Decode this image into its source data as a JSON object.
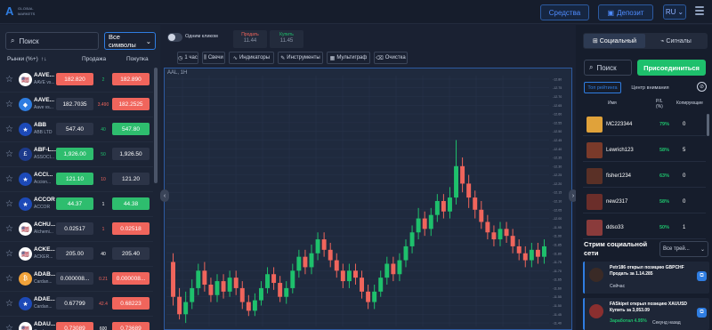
{
  "header": {
    "logo_line1": "GLOBAL",
    "logo_line2": "MARKETS",
    "funds_label": "Средства",
    "deposit_label": "Депозит",
    "lang": "RU"
  },
  "left": {
    "search_placeholder": "Поиск",
    "filter_value": "Все символы",
    "col_market": "Рынки (%+)",
    "col_sell": "Продажа",
    "col_buy": "Покупка",
    "rows": [
      {
        "sym": "AAVE...",
        "name": "AAVE vs...",
        "flag": "🇺🇸",
        "flagbg": "#ffffff",
        "sell": "182.820",
        "sellc": "red",
        "spread": "2",
        "spreadc": "#1ec06c",
        "buy": "182.890",
        "buyc": "red"
      },
      {
        "sym": "AAVE...",
        "name": "Aave vs...",
        "flag": "◆",
        "flagbg": "#2e7de1",
        "sell": "182.7035",
        "sellc": "gray",
        "spread": "3.490",
        "spreadc": "#f0655c",
        "buy": "182.2525",
        "buyc": "red"
      },
      {
        "sym": "ABB",
        "name": "ABB LTD",
        "flag": "★",
        "flagbg": "#1d4ab8",
        "sell": "547.40",
        "sellc": "gray",
        "spread": "40",
        "spreadc": "#1ec06c",
        "buy": "547.80",
        "buyc": "green"
      },
      {
        "sym": "ABF-L...",
        "name": "ASSOCI...",
        "flag": "£",
        "flagbg": "#1d3b8c",
        "sell": "1,926.00",
        "sellc": "green",
        "spread": "50",
        "spreadc": "#1ec06c",
        "buy": "1,926.50",
        "buyc": "gray"
      },
      {
        "sym": "ACCI...",
        "name": "Accion...",
        "flag": "★",
        "flagbg": "#1d4ab8",
        "sell": "121.10",
        "sellc": "green",
        "spread": "10",
        "spreadc": "#f0655c",
        "buy": "121.20",
        "buyc": "gray"
      },
      {
        "sym": "ACCOR",
        "name": "ACCOR",
        "flag": "★",
        "flagbg": "#1d4ab8",
        "sell": "44.37",
        "sellc": "green",
        "spread": "1",
        "spreadc": "#ffffff",
        "buy": "44.38",
        "buyc": "green"
      },
      {
        "sym": "ACHU...",
        "name": "Alchemi...",
        "flag": "🇺🇸",
        "flagbg": "#ffffff",
        "sell": "0.02517",
        "sellc": "gray",
        "spread": "1",
        "spreadc": "#f0655c",
        "buy": "0.02518",
        "buyc": "red"
      },
      {
        "sym": "ACKE...",
        "name": "ACKER...",
        "flag": "🇺🇸",
        "flagbg": "#ffffff",
        "sell": "205.00",
        "sellc": "gray",
        "spread": "40",
        "spreadc": "#ffffff",
        "buy": "205.40",
        "buyc": "gray"
      },
      {
        "sym": "ADAB...",
        "name": "Cardan...",
        "flag": "₿",
        "flagbg": "#f2a33a",
        "sell": "0.000008...",
        "sellc": "gray",
        "spread": "0.21",
        "spreadc": "#f0655c",
        "buy": "0.000008...",
        "buyc": "red"
      },
      {
        "sym": "ADAE...",
        "name": "Cardan...",
        "flag": "★",
        "flagbg": "#1d4ab8",
        "sell": "0.67799",
        "sellc": "gray",
        "spread": "42.4",
        "spreadc": "#f0655c",
        "buy": "0.68223",
        "buyc": "red"
      },
      {
        "sym": "ADAU...",
        "name": "Cardan...",
        "flag": "🇺🇸",
        "flagbg": "#ffffff",
        "sell": "0.73089",
        "sellc": "red",
        "spread": "600",
        "spreadc": "#ffffff",
        "buy": "0.73689",
        "buyc": "red"
      }
    ]
  },
  "toolbar": {
    "toggle_label": "Одним кликом",
    "sell_label": "Продать",
    "sell_value": "11.44",
    "buy_label": "Купить",
    "buy_value": "11.45",
    "tools": [
      {
        "label": "1 час",
        "icon": "clock-icon"
      },
      {
        "label": "Свечи",
        "icon": "candles-icon"
      },
      {
        "label": "Индикаторы",
        "icon": "indicators-icon"
      },
      {
        "label": "Инструменты",
        "icon": "tools-icon"
      },
      {
        "label": "Мультиграф",
        "icon": "multichart-icon"
      },
      {
        "label": "Очистка",
        "icon": "trash-icon"
      }
    ]
  },
  "chart": {
    "title": "AAL, 1H"
  },
  "chart_data": {
    "type": "candlestick",
    "title": "AAL, 1H",
    "y_ticks": [
      12.8,
      12.75,
      12.7,
      12.65,
      12.6,
      12.55,
      12.5,
      12.45,
      12.4,
      12.35,
      12.3,
      12.25,
      12.2,
      12.15,
      12.1,
      12.05,
      12,
      11.95,
      11.9,
      11.85,
      11.8,
      11.75,
      11.7,
      11.65,
      11.6,
      11.55,
      11.5,
      11.45,
      11.4
    ],
    "y_range": [
      11.38,
      12.82
    ],
    "candles": [
      [
        11.75,
        11.55,
        11.8,
        11.5
      ],
      [
        11.55,
        11.45,
        11.6,
        11.42
      ],
      [
        11.45,
        11.52,
        11.58,
        11.4
      ],
      [
        11.52,
        11.6,
        11.65,
        11.48
      ],
      [
        11.6,
        11.7,
        11.74,
        11.56
      ],
      [
        11.7,
        11.62,
        11.75,
        11.58
      ],
      [
        11.62,
        11.56,
        11.66,
        11.52
      ],
      [
        11.56,
        11.64,
        11.68,
        11.52
      ],
      [
        11.64,
        11.58,
        11.68,
        11.54
      ],
      [
        11.58,
        11.66,
        11.7,
        11.55
      ],
      [
        11.66,
        11.6,
        11.7,
        11.56
      ],
      [
        11.6,
        11.52,
        11.64,
        11.48
      ],
      [
        11.52,
        11.47,
        11.56,
        11.44
      ],
      [
        11.47,
        11.53,
        11.57,
        11.44
      ],
      [
        11.53,
        11.6,
        11.64,
        11.5
      ],
      [
        11.6,
        11.68,
        11.72,
        11.57
      ],
      [
        11.68,
        11.63,
        11.72,
        11.59
      ],
      [
        11.63,
        11.55,
        11.67,
        11.52
      ],
      [
        11.55,
        11.6,
        11.64,
        11.51
      ],
      [
        11.6,
        11.7,
        11.74,
        11.57
      ],
      [
        11.7,
        11.78,
        11.82,
        11.66
      ],
      [
        11.78,
        11.72,
        11.82,
        11.68
      ],
      [
        11.72,
        11.8,
        11.85,
        11.68
      ],
      [
        11.8,
        11.88,
        11.92,
        11.76
      ],
      [
        11.88,
        11.82,
        11.92,
        11.78
      ],
      [
        11.82,
        11.76,
        11.86,
        11.72
      ],
      [
        11.76,
        11.7,
        11.8,
        11.66
      ],
      [
        11.7,
        11.64,
        11.74,
        11.6
      ],
      [
        11.64,
        11.7,
        11.74,
        11.6
      ],
      [
        11.7,
        11.66,
        11.74,
        11.62
      ],
      [
        11.66,
        11.58,
        11.7,
        11.54
      ],
      [
        11.58,
        11.52,
        11.62,
        11.48
      ],
      [
        11.52,
        11.58,
        11.62,
        11.48
      ],
      [
        11.58,
        11.66,
        11.7,
        11.55
      ],
      [
        11.66,
        11.74,
        11.78,
        11.62
      ],
      [
        11.74,
        11.68,
        11.78,
        11.64
      ],
      [
        11.68,
        11.76,
        11.8,
        11.64
      ],
      [
        11.76,
        11.84,
        11.88,
        11.72
      ],
      [
        11.84,
        11.92,
        11.96,
        11.8
      ],
      [
        11.92,
        12.0,
        12.06,
        11.88
      ],
      [
        12.0,
        11.94,
        12.04,
        11.9
      ],
      [
        11.94,
        12.02,
        12.06,
        11.9
      ],
      [
        12.02,
        12.1,
        12.14,
        11.98
      ],
      [
        12.1,
        12.04,
        12.14,
        12.0
      ],
      [
        12.04,
        12.12,
        12.18,
        12.0
      ],
      [
        12.12,
        12.3,
        12.45,
        12.08
      ],
      [
        12.3,
        12.2,
        12.35,
        12.15
      ],
      [
        12.2,
        12.12,
        12.25,
        12.06
      ],
      [
        12.12,
        12.05,
        12.16,
        12.0
      ],
      [
        12.05,
        11.98,
        12.1,
        11.94
      ],
      [
        11.98,
        11.92,
        12.02,
        11.88
      ],
      [
        11.92,
        11.88,
        11.96,
        11.84
      ],
      [
        11.88,
        11.94,
        11.98,
        11.84
      ],
      [
        11.94,
        11.9,
        11.98,
        11.86
      ],
      [
        11.9,
        11.84,
        11.94,
        11.8
      ],
      [
        11.84,
        11.8,
        11.88,
        11.76
      ],
      [
        11.8,
        11.76,
        11.84,
        11.72
      ],
      [
        11.76,
        11.82,
        11.86,
        11.72
      ],
      [
        11.82,
        11.78,
        11.86,
        11.74
      ],
      [
        11.78,
        11.84,
        11.88,
        11.74
      ]
    ]
  },
  "right": {
    "tab_social": "Социальный",
    "tab_signals": "Сигналы",
    "search_placeholder": "Поиск",
    "join_label": "Присоединиться",
    "subtab_top": "Топ рейтинга",
    "subtab_center": "Центр внимания",
    "head_name": "Имя",
    "head_pl": "P/L (%)",
    "head_copiers": "Копирующие",
    "traders": [
      {
        "name": "MC223344",
        "pct": "79%",
        "copiers": "0",
        "avbg": "#e0a23a"
      },
      {
        "name": "Lewrich123",
        "pct": "58%",
        "copiers": "5",
        "avbg": "#7a3a2a"
      },
      {
        "name": "fisher1234",
        "pct": "63%",
        "copiers": "0",
        "avbg": "#5a3026"
      },
      {
        "name": "new2317",
        "pct": "58%",
        "copiers": "0",
        "avbg": "#6b2e2a"
      },
      {
        "name": "ddso33",
        "pct": "50%",
        "copiers": "1",
        "avbg": "#8a3b3b"
      }
    ],
    "stream_title": "Стрим социальной сети",
    "stream_filter": "Все трей...",
    "posts": [
      {
        "text": "Petr186 открыл позицию GBPCHF Продать за 1.14.285",
        "sub": "Сейчас",
        "sub2": "",
        "avbg": "#3a2a26"
      },
      {
        "text": "FASkipet открыл позицию XAUUSD Купить за 3,053.09",
        "sub": "Заработал 4.95%",
        "sub2": "Секунд назад",
        "avbg": "#8a2f2f"
      }
    ]
  }
}
